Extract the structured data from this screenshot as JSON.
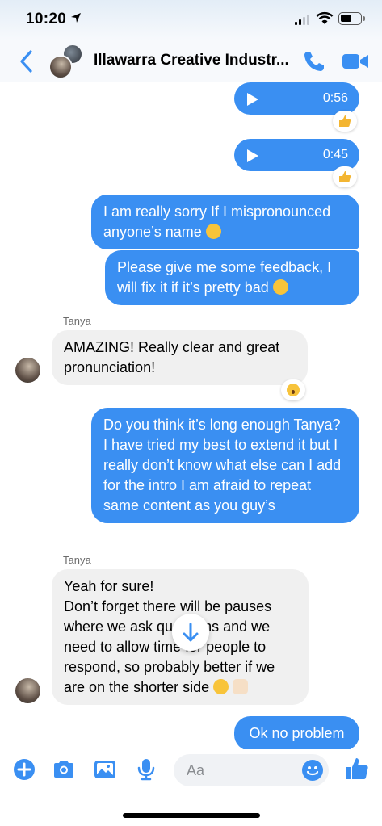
{
  "status_bar": {
    "time": "10:20"
  },
  "header": {
    "title": "Illawarra Creative Industr..."
  },
  "thread": {
    "audio_messages": [
      {
        "duration": "0:56",
        "reaction": "thumbs-up"
      },
      {
        "duration": "0:45",
        "reaction": "thumbs-up"
      }
    ],
    "msg1": "I am really sorry If I mispronounced anyone’s name",
    "msg2": "Please give me some feedback, I will fix it if it’s pretty bad",
    "tanya_label_1": "Tanya",
    "reply1": "AMAZING! Really clear and great pronunciation!",
    "msg3": "Do you think it’s long enough Tanya? I have tried my best to extend it but I really don’t know what else can I add for the intro I am afraid to repeat same content as you guy’s",
    "tanya_label_2": "Tanya",
    "reply2_line1": "Yeah for sure!",
    "reply2_line2": "Don’t forget there will be pauses where we ask questions and we need to allow time for people to respond, so probably better if we are on the shorter side",
    "msg4": "Ok no problem"
  },
  "composer": {
    "placeholder": "Aa"
  },
  "colors": {
    "accent": "#3a8ff2",
    "incoming": "#f0f0f0"
  }
}
